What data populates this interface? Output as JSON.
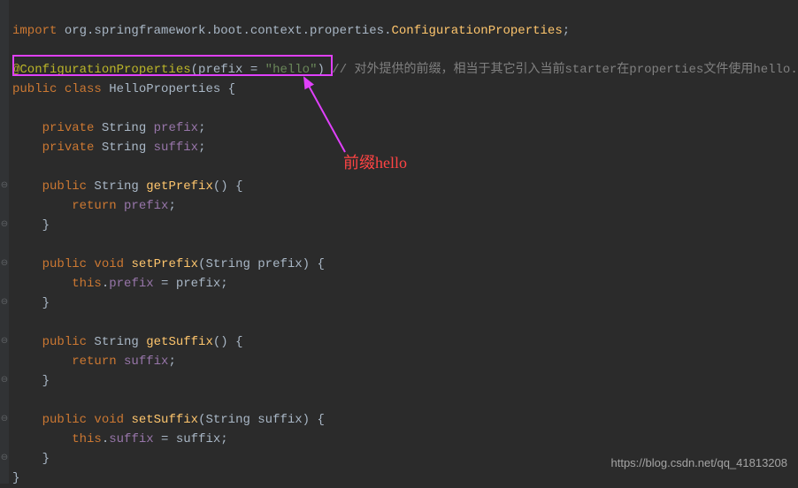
{
  "code": {
    "import_kw": "import ",
    "import_pkg": "org.springframework.boot.context.properties.",
    "import_cls": "ConfigurationProperties",
    "import_semi": ";",
    "anno_name": "@ConfigurationProperties",
    "anno_open": "(",
    "anno_param": "prefix = ",
    "anno_str": "\"hello\"",
    "anno_close": ")",
    "anno_comment": " // 对外提供的前缀，相当于其它引入当前starter在properties文件使用hello.属",
    "class_decl_public": "public ",
    "class_decl_class": "class ",
    "class_name": "HelloProperties ",
    "class_open": "{",
    "private_kw": "private ",
    "string_type": "String ",
    "field_prefix": "prefix",
    "field_suffix": "suffix",
    "semi": ";",
    "public_kw": "public ",
    "void_kw": "void ",
    "getPrefix": "getPrefix",
    "setPrefix": "setPrefix",
    "getSuffix": "getSuffix",
    "setSuffix": "setSuffix",
    "parens_empty": "() ",
    "brace_open": "{",
    "brace_close": "}",
    "return_kw": "return ",
    "this_kw": "this",
    "dot": ".",
    "equals": " = ",
    "param_prefix": "prefix",
    "param_suffix": "suffix",
    "setPrefix_params": "(String prefix) ",
    "setSuffix_params": "(String suffix) "
  },
  "annotation": {
    "text": "前缀hello"
  },
  "watermark": "https://blog.csdn.net/qq_41813208"
}
